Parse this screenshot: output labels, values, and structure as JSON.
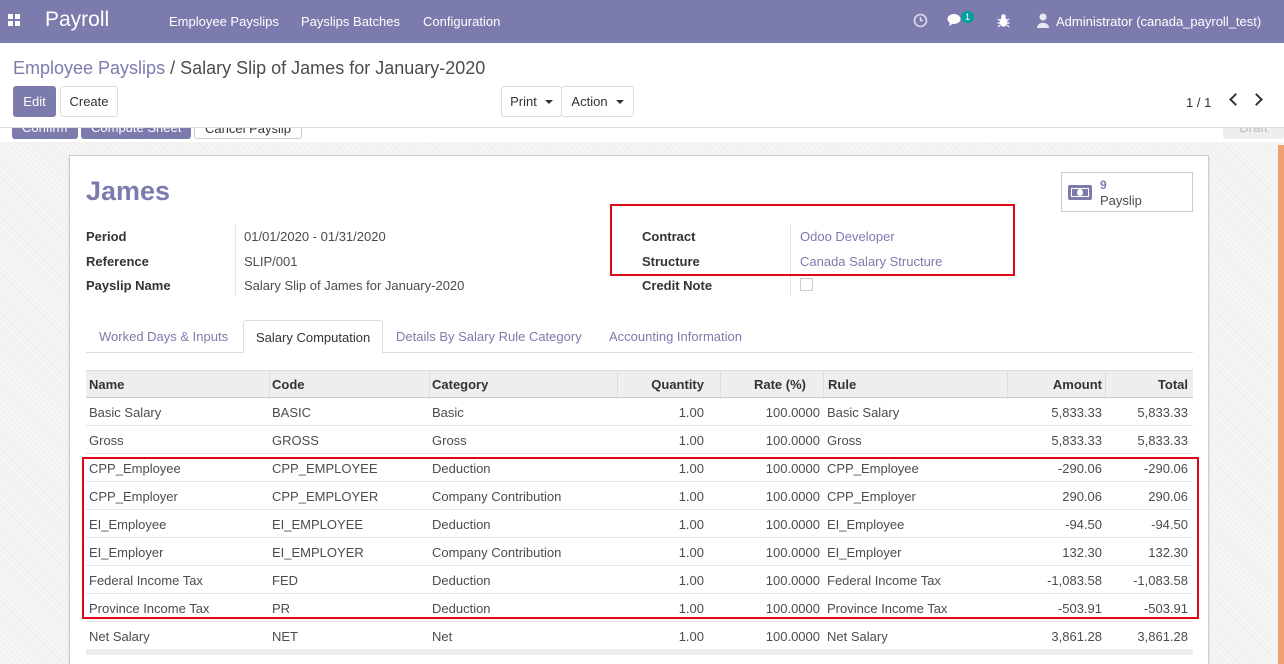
{
  "navbar": {
    "app_title": "Payroll",
    "menus": [
      "Employee Payslips",
      "Payslips Batches",
      "Configuration"
    ],
    "message_count": "1",
    "user": "Administrator (canada_payroll_test)"
  },
  "breadcrumb": {
    "parent": "Employee Payslips",
    "separator": "/",
    "current": "Salary Slip of James for January-2020"
  },
  "buttons": {
    "edit": "Edit",
    "create": "Create",
    "print": "Print",
    "action": "Action"
  },
  "pager": "1 / 1",
  "status_buttons": {
    "confirm": "Confirm",
    "compute": "Compute Sheet",
    "cancel": "Cancel Payslip",
    "draft": "Draft"
  },
  "employee": "James",
  "smart_button": {
    "count": "9",
    "label": "Payslip"
  },
  "fields": {
    "period_label": "Period",
    "period_value": "01/01/2020 - 01/31/2020",
    "reference_label": "Reference",
    "reference_value": "SLIP/001",
    "name_label": "Payslip Name",
    "name_value": "Salary Slip of James for January-2020",
    "contract_label": "Contract",
    "contract_value": "Odoo Developer",
    "structure_label": "Structure",
    "structure_value": "Canada Salary Structure",
    "credit_note_label": "Credit Note"
  },
  "tabs": [
    "Worked Days & Inputs",
    "Salary Computation",
    "Details By Salary Rule Category",
    "Accounting Information"
  ],
  "table": {
    "headers": [
      "Name",
      "Code",
      "Category",
      "Quantity",
      "Rate (%)",
      "Rule",
      "Amount",
      "Total"
    ],
    "rows": [
      [
        "Basic Salary",
        "BASIC",
        "Basic",
        "1.00",
        "100.0000",
        "Basic Salary",
        "5,833.33",
        "5,833.33"
      ],
      [
        "Gross",
        "GROSS",
        "Gross",
        "1.00",
        "100.0000",
        "Gross",
        "5,833.33",
        "5,833.33"
      ],
      [
        "CPP_Employee",
        "CPP_EMPLOYEE",
        "Deduction",
        "1.00",
        "100.0000",
        "CPP_Employee",
        "-290.06",
        "-290.06"
      ],
      [
        "CPP_Employer",
        "CPP_EMPLOYER",
        "Company Contribution",
        "1.00",
        "100.0000",
        "CPP_Employer",
        "290.06",
        "290.06"
      ],
      [
        "EI_Employee",
        "EI_EMPLOYEE",
        "Deduction",
        "1.00",
        "100.0000",
        "EI_Employee",
        "-94.50",
        "-94.50"
      ],
      [
        "EI_Employer",
        "EI_EMPLOYER",
        "Company Contribution",
        "1.00",
        "100.0000",
        "EI_Employer",
        "132.30",
        "132.30"
      ],
      [
        "Federal Income Tax",
        "FED",
        "Deduction",
        "1.00",
        "100.0000",
        "Federal Income Tax",
        "-1,083.58",
        "-1,083.58"
      ],
      [
        "Province Income Tax",
        "PR",
        "Deduction",
        "1.00",
        "100.0000",
        "Province Income Tax",
        "-503.91",
        "-503.91"
      ],
      [
        "Net Salary",
        "NET",
        "Net",
        "1.00",
        "100.0000",
        "Net Salary",
        "3,861.28",
        "3,861.28"
      ]
    ]
  }
}
